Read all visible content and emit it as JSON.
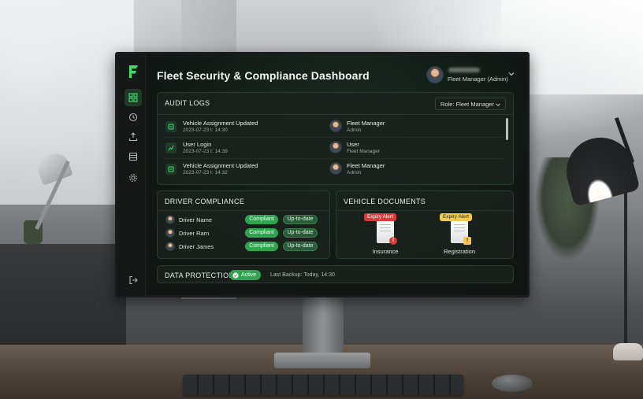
{
  "header": {
    "title": "Fleet Security & Compliance Dashboard",
    "user_role": "Fleet Manager (Admin)"
  },
  "sidebar": {
    "items": [
      {
        "icon": "dashboard-icon",
        "active": true
      },
      {
        "icon": "history-icon",
        "active": false
      },
      {
        "icon": "upload-icon",
        "active": false
      },
      {
        "icon": "database-icon",
        "active": false
      },
      {
        "icon": "gear-icon",
        "active": false
      }
    ],
    "logout_icon": "logout-icon"
  },
  "audit_logs": {
    "title": "AUDIT LOGS",
    "role_filter": "Role: Fleet Manager",
    "rows": [
      {
        "event": "Vehicle Assignment Updated",
        "time": "2023-07-23 t: 14:30",
        "user": "Fleet Manager",
        "user_role": "Admin"
      },
      {
        "event": "User Login",
        "time": "2023-07-23 t: 14:39",
        "user": "User",
        "user_role": "Fleet Manager"
      },
      {
        "event": "Vehicle Assignment Updated",
        "time": "2023-07-23 t: 14:32",
        "user": "Fleet Manager",
        "user_role": "Admin"
      }
    ]
  },
  "driver_compliance": {
    "title": "DRIVER COMPLIANCE",
    "rows": [
      {
        "name": "Driver Name",
        "status": "Compliant",
        "docs": "Up-to-date"
      },
      {
        "name": "Driver Rarn",
        "status": "Compliant",
        "docs": "Up-to-date"
      },
      {
        "name": "Driver James",
        "status": "Compliant",
        "docs": "Up-to-date"
      }
    ]
  },
  "vehicle_documents": {
    "title": "VEHICLE DOCUMENTS",
    "docs": [
      {
        "label": "Insurance",
        "alert": "Expiry Alert",
        "alert_color": "#d93a3a"
      },
      {
        "label": "Registration",
        "alert": "Expiry Alert",
        "alert_color": "#f2c94c"
      }
    ]
  },
  "data_protection": {
    "title": "DATA PROTECTION:",
    "status": "Active",
    "last_backup": "Last Backup: Today, 14:30"
  },
  "colors": {
    "accent": "#2ea44f",
    "background": "#121815",
    "alert_red": "#d93a3a",
    "alert_yellow": "#f2c94c"
  }
}
